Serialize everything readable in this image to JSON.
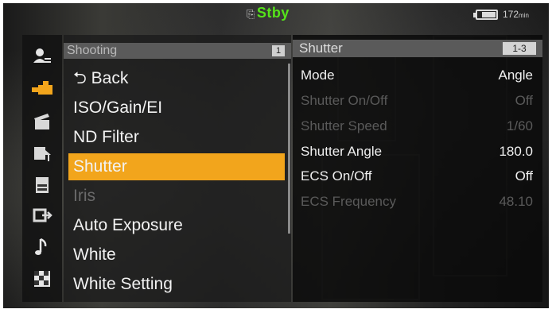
{
  "status": {
    "record_state": "Stby",
    "battery_minutes": "172",
    "battery_unit": "min"
  },
  "side_icons": [
    {
      "name": "user-menu-icon"
    },
    {
      "name": "camera-shooting-icon",
      "active": true
    },
    {
      "name": "clapperboard-icon"
    },
    {
      "name": "paint-edit-icon"
    },
    {
      "name": "media-card-icon"
    },
    {
      "name": "output-icon"
    },
    {
      "name": "audio-note-icon"
    },
    {
      "name": "checkerboard-icon"
    }
  ],
  "menu": {
    "title": "Shooting",
    "page": "1",
    "items": [
      {
        "label": "⮌ Back",
        "state": "normal"
      },
      {
        "label": "ISO/Gain/EI",
        "state": "normal"
      },
      {
        "label": "ND Filter",
        "state": "normal"
      },
      {
        "label": "Shutter",
        "state": "selected"
      },
      {
        "label": "Iris",
        "state": "disabled"
      },
      {
        "label": "Auto Exposure",
        "state": "normal"
      },
      {
        "label": "White",
        "state": "normal"
      },
      {
        "label": "White Setting",
        "state": "normal"
      }
    ]
  },
  "detail": {
    "title": "Shutter",
    "page": "1-3",
    "rows": [
      {
        "label": "Mode",
        "value": "Angle",
        "state": "normal"
      },
      {
        "label": "Shutter On/Off",
        "value": "Off",
        "state": "disabled"
      },
      {
        "label": "Shutter Speed",
        "value": "1/60",
        "state": "disabled"
      },
      {
        "label": "Shutter Angle",
        "value": "180.0",
        "state": "normal"
      },
      {
        "label": "ECS On/Off",
        "value": "Off",
        "state": "normal"
      },
      {
        "label": "ECS Frequency",
        "value": "48.10",
        "state": "disabled"
      }
    ]
  },
  "colors": {
    "highlight": "#f2a51c",
    "standby": "#55e31a"
  }
}
